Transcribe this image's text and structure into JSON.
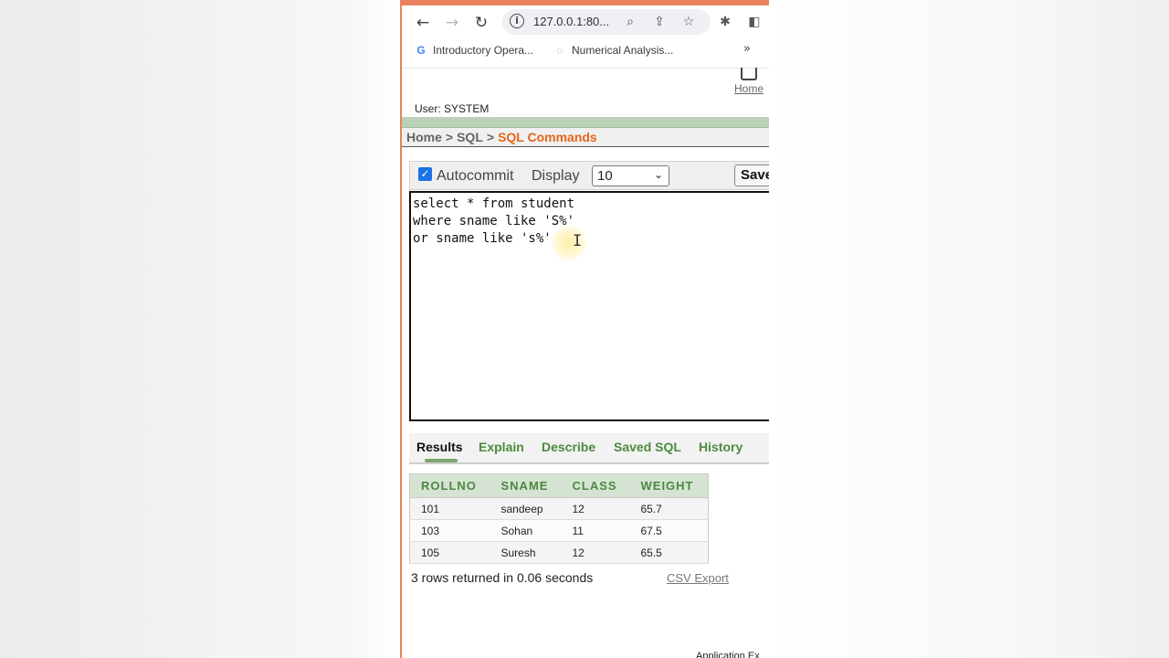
{
  "browser": {
    "url": "127.0.0.1:80...",
    "bookmarks": [
      {
        "icon": "G",
        "label": "Introductory Opera..."
      },
      {
        "icon": "◌",
        "label": "Numerical Analysis..."
      }
    ],
    "more": "»"
  },
  "header": {
    "home_label": "Home",
    "user_line": "User: SYSTEM"
  },
  "breadcrumb": {
    "items": [
      "Home",
      "SQL"
    ],
    "separator": ">",
    "current": "SQL Commands"
  },
  "toolbar": {
    "autocommit_label": "Autocommit",
    "autocommit_checked": true,
    "display_label": "Display",
    "display_value": "10",
    "save_label": "Save"
  },
  "editor": {
    "sql": "select * from student\nwhere sname like 'S%'\nor sname like 's%'"
  },
  "tabs": [
    {
      "label": "Results",
      "active": true
    },
    {
      "label": "Explain",
      "active": false
    },
    {
      "label": "Describe",
      "active": false
    },
    {
      "label": "Saved SQL",
      "active": false
    },
    {
      "label": "History",
      "active": false
    }
  ],
  "results": {
    "columns": [
      "ROLLNO",
      "SNAME",
      "CLASS",
      "WEIGHT"
    ],
    "rows": [
      [
        "101",
        "sandeep",
        "12",
        "65.7"
      ],
      [
        "103",
        "Sohan",
        "11",
        "67.5"
      ],
      [
        "105",
        "Suresh",
        "12",
        "65.5"
      ]
    ],
    "summary": "3 rows returned in 0.06 seconds",
    "csv_label": "CSV Export"
  },
  "footer": {
    "text": "Application Ex"
  },
  "colors": {
    "accent_orange": "#e5661b",
    "tab_green": "#4d8a3e",
    "header_green": "#d5e4d2"
  }
}
